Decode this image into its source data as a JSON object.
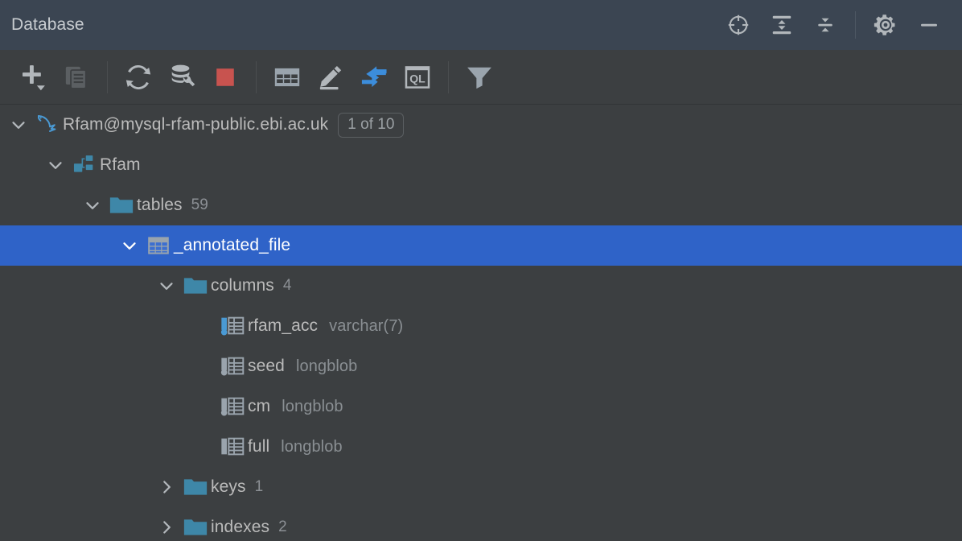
{
  "header": {
    "title": "Database",
    "actions": [
      {
        "name": "locate-icon",
        "label": "Scroll from Source"
      },
      {
        "name": "expand-all-icon",
        "label": "Expand All"
      },
      {
        "name": "collapse-all-icon",
        "label": "Collapse All"
      },
      {
        "name": "separator",
        "label": ""
      },
      {
        "name": "gear-icon",
        "label": "Settings"
      },
      {
        "name": "minimize-icon",
        "label": "Hide"
      }
    ]
  },
  "toolbar": {
    "buttons": [
      {
        "name": "add-icon",
        "label": "New"
      },
      {
        "name": "copy-icon",
        "label": "Duplicate"
      },
      {
        "name": "separator",
        "label": ""
      },
      {
        "name": "refresh-icon",
        "label": "Refresh"
      },
      {
        "name": "db-properties-icon",
        "label": "Properties"
      },
      {
        "name": "stop-icon",
        "label": "Stop"
      },
      {
        "name": "separator",
        "label": ""
      },
      {
        "name": "table-editor-icon",
        "label": "Data Editor"
      },
      {
        "name": "edit-icon",
        "label": "Modify"
      },
      {
        "name": "sync-icon",
        "label": "Synchronize"
      },
      {
        "name": "query-console-icon",
        "label": "QL"
      },
      {
        "name": "separator",
        "label": ""
      },
      {
        "name": "filter-icon",
        "label": "Filter"
      }
    ]
  },
  "tree": {
    "rows": [
      {
        "id": "datasource",
        "label": "Rfam@mysql-rfam-public.ebi.ac.uk",
        "badge": "1 of 10",
        "meta": "",
        "dtype": "",
        "icon": "mysql-dolphin-icon",
        "twisty": "expanded",
        "indent": 0,
        "selected": false
      },
      {
        "id": "schema-rfam",
        "label": "Rfam",
        "badge": "",
        "meta": "",
        "dtype": "",
        "icon": "schema-icon",
        "twisty": "expanded",
        "indent": 1,
        "selected": false
      },
      {
        "id": "group-tables",
        "label": "tables",
        "badge": "",
        "meta": "59",
        "dtype": "",
        "icon": "folder-icon",
        "twisty": "expanded",
        "indent": 2,
        "selected": false
      },
      {
        "id": "table-annotated-file",
        "label": "_annotated_file",
        "badge": "",
        "meta": "",
        "dtype": "",
        "icon": "table-icon",
        "twisty": "expanded",
        "indent": 3,
        "selected": true
      },
      {
        "id": "group-columns",
        "label": "columns",
        "badge": "",
        "meta": "4",
        "dtype": "",
        "icon": "folder-icon",
        "twisty": "expanded",
        "indent": 4,
        "selected": false
      },
      {
        "id": "column-rfam-acc",
        "label": "rfam_acc",
        "badge": "",
        "meta": "",
        "dtype": "varchar(7)",
        "icon": "column-key-icon",
        "twisty": "none",
        "indent": 5,
        "selected": false
      },
      {
        "id": "column-seed",
        "label": "seed",
        "badge": "",
        "meta": "",
        "dtype": "longblob",
        "icon": "column-nullable-icon",
        "twisty": "none",
        "indent": 5,
        "selected": false
      },
      {
        "id": "column-cm",
        "label": "cm",
        "badge": "",
        "meta": "",
        "dtype": "longblob",
        "icon": "column-nullable-icon",
        "twisty": "none",
        "indent": 5,
        "selected": false
      },
      {
        "id": "column-full",
        "label": "full",
        "badge": "",
        "meta": "",
        "dtype": "longblob",
        "icon": "column-icon",
        "twisty": "none",
        "indent": 5,
        "selected": false
      },
      {
        "id": "group-keys",
        "label": "keys",
        "badge": "",
        "meta": "1",
        "dtype": "",
        "icon": "folder-icon",
        "twisty": "collapsed",
        "indent": 4,
        "selected": false
      },
      {
        "id": "group-indexes",
        "label": "indexes",
        "badge": "",
        "meta": "2",
        "dtype": "",
        "icon": "folder-icon",
        "twisty": "collapsed",
        "indent": 4,
        "selected": false
      }
    ]
  },
  "colors": {
    "header_bg": "#3b4552",
    "body_bg": "#3c3f41",
    "selection": "#2f63c8",
    "folder": "#3e87a8",
    "accent_blue": "#4a9ad4",
    "stop_red": "#c8534f",
    "text": "#bbbbbb",
    "text_dim": "#8a8f93"
  }
}
